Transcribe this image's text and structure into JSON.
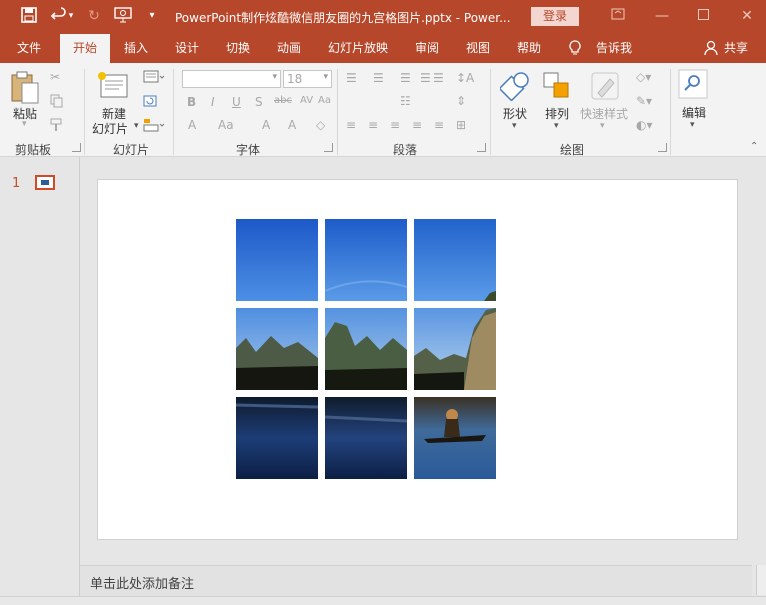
{
  "titlebar": {
    "document_title": "PowerPoint制作炫酷微信朋友圈的九宫格图片.pptx - Power...",
    "login_label": "登录",
    "bg_color": "#b7472a",
    "icons": [
      "save-icon",
      "undo-icon",
      "undo-dropdown-icon",
      "redo-icon",
      "present-from-start-icon",
      "customize-qat-icon"
    ]
  },
  "tabs": [
    "文件",
    "开始",
    "插入",
    "设计",
    "切换",
    "动画",
    "幻灯片放映",
    "审阅",
    "视图",
    "帮助"
  ],
  "active_tab": "开始",
  "tell_me": "告诉我",
  "share": "共享",
  "ribbon": {
    "clipboard": {
      "paste_label": "粘贴",
      "group_label": "剪贴板"
    },
    "slides": {
      "new_slide_label_1": "新建",
      "new_slide_label_2": "幻灯片",
      "group_label": "幻灯片"
    },
    "font": {
      "font_name": "",
      "font_size": "18",
      "group_label": "字体"
    },
    "paragraph": {
      "group_label": "段落"
    },
    "drawing": {
      "shapes_label": "形状",
      "arrange_label": "排列",
      "quick_styles_label": "快速样式",
      "group_label": "绘图"
    },
    "editing": {
      "edit_label": "编辑"
    }
  },
  "thumbnails": [
    {
      "number": "1"
    }
  ],
  "notes_placeholder": "单击此处添加备注",
  "accent_color": "#b7472a"
}
